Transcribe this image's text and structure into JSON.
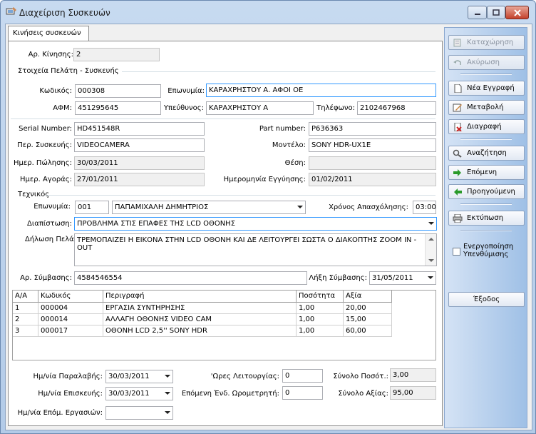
{
  "window": {
    "title": "Διαχείριση Συσκευών"
  },
  "tabs": [
    {
      "label": "Κινήσεις συσκευών"
    }
  ],
  "movement": {
    "label": "Αρ. Κίνησης:",
    "value": "2"
  },
  "customer_section": {
    "title": "Στοιχεία Πελάτη - Συσκευής",
    "code_label": "Κωδικός:",
    "code": "000308",
    "name_label": "Επωνυμία:",
    "name": "ΚΑΡΑΧΡΗΣΤΟΥ Α. ΑΦΟΙ ΟΕ",
    "afm_label": "ΑΦΜ:",
    "afm": "451295645",
    "responsible_label": "Υπεύθυνος:",
    "responsible": "ΚΑΡΑΧΡΗΣΤΟΥ Α",
    "phone_label": "Τηλέφωνο:",
    "phone": "2102467968"
  },
  "device": {
    "serial_label": "Serial Number:",
    "serial": "HD451548R",
    "part_label": "Part number:",
    "part": "P636363",
    "desc_label": "Περ. Συσκευής:",
    "desc": "VIDEOCAMERA",
    "model_label": "Μοντέλο:",
    "model": "SONY HDR-UX1E",
    "sale_date_label": "Ημερ. Πώλησης:",
    "sale_date": "30/03/2011",
    "position_label": "Θέση:",
    "position": "",
    "purchase_date_label": "Ημερ. Αγοράς:",
    "purchase_date": "27/01/2011",
    "warranty_label": "Ημερομηνία Εγγύησης:",
    "warranty": "01/02/2011"
  },
  "technician": {
    "title": "Τεχνικός",
    "name_label": "Επωνυμία:",
    "code": "001",
    "name": "ΠΑΠΑΜΙΧΑΛΗ ΔΗΜΗΤΡΙΟΣ",
    "time_label": "Χρόνος Απασχόλησης:",
    "time": "03:00",
    "diagnosis_label": "Διαπίστωση:",
    "diagnosis": "ΠΡΟΒΛΗΜΑ ΣΤΙΣ ΕΠΑΦΕΣ ΤΗΣ LCD ΟΘΟΝΗΣ",
    "statement_label": "Δήλωση Πελάτη:",
    "statement": "ΤΡΕΜΟΠΑΙΖΕΙ Η ΕΙΚΟΝΑ ΣΤΗΝ LCD ΟΘΟΝΗ ΚΑΙ ΔΕ ΛΕΙΤΟΥΡΓΕΙ ΣΩΣΤΑ Ο ΔΙΑΚΟΠΤΗΣ ZOOM IN - OUT"
  },
  "contract": {
    "number_label": "Αρ. Σύμβασης:",
    "number": "4584546554",
    "expiry_label": "Λήξη Σύμβασης:",
    "expiry": "31/05/2011"
  },
  "grid": {
    "columns": [
      "Α/Α",
      "Κωδικός",
      "Περιγραφή",
      "Ποσότητα",
      "Αξία"
    ],
    "rows": [
      [
        "1",
        "000004",
        "ΕΡΓΑΣΙΑ ΣΥΝΤΗΡΗΣΗΣ",
        "1,00",
        "20,00"
      ],
      [
        "2",
        "000014",
        "ΑΛΛΑΓΗ ΟΘΟΝΗΣ VIDEO CAM",
        "1,00",
        "15,00"
      ],
      [
        "3",
        "000017",
        "ΟΘΟΝΗ LCD 2,5'' SONY HDR",
        "1,00",
        "60,00"
      ]
    ]
  },
  "footer": {
    "receipt_label": "Ημ/νία Παραλαβής:",
    "receipt": "30/03/2011",
    "hours_label": "'Ωρες Λειτουργίας:",
    "hours": "0",
    "total_qty_label": "Σύνολο Ποσότ.:",
    "total_qty": "3,00",
    "repair_label": "Ημ/νία Επισκευής:",
    "repair": "30/03/2011",
    "next_meter_label": "Επόμενη Ένδ. Ωρομετρητή:",
    "next_meter": "0",
    "total_value_label": "Σύνολο Αξίας:",
    "total_value": "95,00",
    "next_work_label": "Ημ/νία Επόμ. Εργασιών:",
    "next_work": ""
  },
  "sidebar": {
    "save": "Καταχώρηση",
    "cancel": "Ακύρωση",
    "new": "Νέα Εγγραφή",
    "edit": "Μεταβολή",
    "delete": "Διαγραφή",
    "search": "Αναζήτηση",
    "next": "Επόμενη",
    "previous": "Προηγούμενη",
    "print": "Εκτύπωση",
    "reminder": "Ενεργοποίηση Υπενθύμισης",
    "exit": "Έξοδος"
  },
  "colors": {
    "accent": "#3399ff",
    "sidebar": "#b3cde9"
  }
}
